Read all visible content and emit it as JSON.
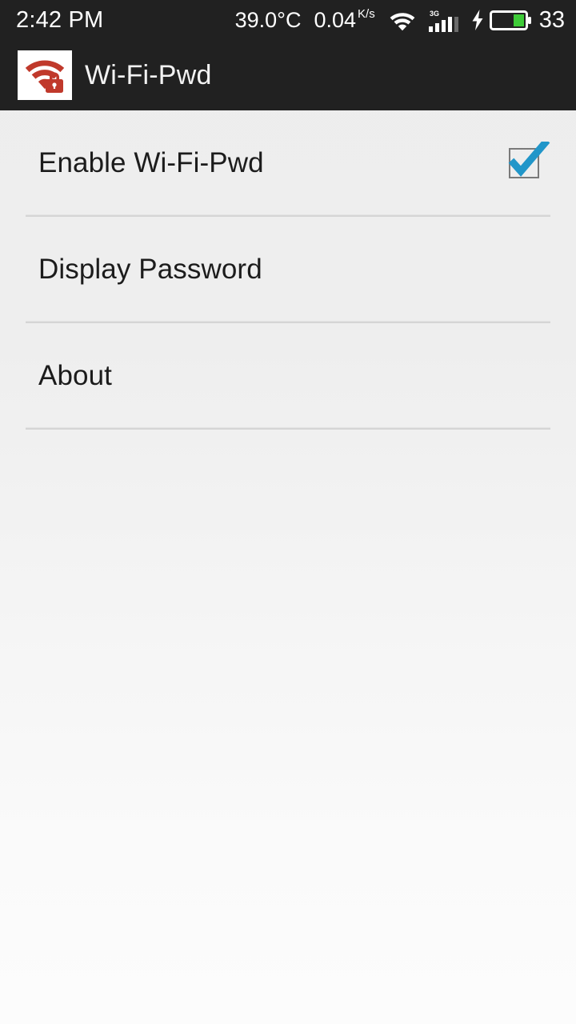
{
  "status_bar": {
    "clock": "2:42 PM",
    "temperature": "39.0°C",
    "net_speed_value": "0.04",
    "net_speed_unit": "K/s",
    "wifi_icon": "wifi-icon",
    "signal_icon": "signal-bars-icon",
    "network_type": "3G",
    "signal_bars_total": 5,
    "signal_bars_active": 4,
    "charging_icon": "charging-bolt-icon",
    "battery_icon": "battery-icon",
    "battery_percent": "33",
    "battery_fill_color": "#3ecb38",
    "background_color": "#212121",
    "text_color": "#ffffff"
  },
  "app_bar": {
    "icon_name": "wifi-lock-app-icon",
    "icon_color": "#c0392b",
    "icon_background": "#ffffff",
    "title": "Wi-Fi-Pwd",
    "background_color": "#212121"
  },
  "preferences": {
    "items": [
      {
        "label": "Enable Wi-Fi-Pwd",
        "name": "enable-wifi-pwd",
        "accessory": "checkbox",
        "checked": true
      },
      {
        "label": "Display Password",
        "name": "display-password",
        "accessory": "none",
        "checked": null
      },
      {
        "label": "About",
        "name": "about",
        "accessory": "none",
        "checked": null
      }
    ],
    "checkbox_checked_color": "#2196c9",
    "checkbox_border_color": "#7a7a7a",
    "divider_color": "#d5d5d5",
    "label_color": "#1c1c1c"
  }
}
